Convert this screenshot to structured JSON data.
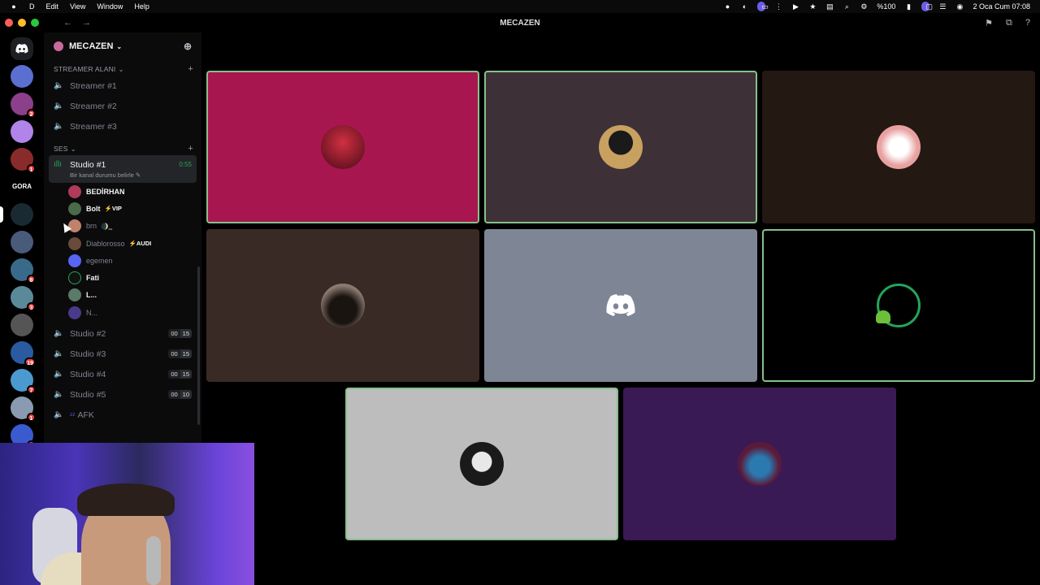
{
  "menubar": {
    "app_name": "D",
    "menus": [
      "Edit",
      "View",
      "Window",
      "Help"
    ],
    "battery": "%100",
    "datetime": "2 Oca Cum  07:08"
  },
  "titlebar": {
    "title": "MECAZEN"
  },
  "rail": {
    "servers": [
      {
        "name": "server-1",
        "color": "#5a6fd0",
        "badge": ""
      },
      {
        "name": "server-2",
        "color": "#8c3f8a",
        "badge": "2"
      },
      {
        "name": "server-3",
        "color": "#b084e8",
        "badge": ""
      },
      {
        "name": "server-4",
        "color": "#8a2b2b",
        "badge": "1"
      },
      {
        "name": "server-gora",
        "label": "GORA",
        "badge": ""
      },
      {
        "name": "server-mecazen",
        "color": "#1a2a33",
        "badge": "",
        "active": true
      },
      {
        "name": "server-7",
        "color": "#4a5a7a",
        "badge": ""
      },
      {
        "name": "server-8",
        "color": "#3a6a8a",
        "badge": "8"
      },
      {
        "name": "server-9",
        "color": "#5a8a9a",
        "badge": "3"
      },
      {
        "name": "server-10",
        "color": "#555",
        "badge": ""
      },
      {
        "name": "server-11",
        "color": "#2a5aa0",
        "badge": "19"
      },
      {
        "name": "server-12",
        "color": "#4a9ad0",
        "badge": "7"
      },
      {
        "name": "server-13",
        "color": "#8a9ab0",
        "badge": "1"
      },
      {
        "name": "server-14",
        "color": "#3a5ad0",
        "badge": "1"
      }
    ]
  },
  "sidebar": {
    "server_name": "MECAZEN",
    "categories": [
      {
        "label": "STREAMER ALANI",
        "channels": [
          {
            "label": "Streamer #1"
          },
          {
            "label": "Streamer #2"
          },
          {
            "label": "Streamer #3"
          }
        ]
      },
      {
        "label": "SES"
      }
    ],
    "active_channel": {
      "label": "Studio #1",
      "timer": "0:55",
      "status": "Bir kanal durumu belirle"
    },
    "members": [
      {
        "name": "BEDİRHAN",
        "color": "#b03a5a"
      },
      {
        "name": "Bolt",
        "tag": "⚡VIP",
        "color": "#4a6a4a"
      },
      {
        "name": "brn",
        "tag": "🌒ꞈꞈ",
        "color": "#c0826a",
        "dim": true
      },
      {
        "name": "Diablorosso",
        "tag": "⚡AUDI",
        "color": "#6a4a3a",
        "dim": true
      },
      {
        "name": "egemen",
        "color": "#5865f2",
        "dim": true
      },
      {
        "name": "Fati",
        "color": "#111"
      },
      {
        "name": "L...",
        "color": "#5a7a6a"
      },
      {
        "name": "N...",
        "color": "#4a3a8a",
        "dim": true
      }
    ],
    "other_channels": [
      {
        "label": "Studio #2",
        "count_a": "00",
        "count_b": "15"
      },
      {
        "label": "Studio #3",
        "count_a": "00",
        "count_b": "15"
      },
      {
        "label": "Studio #4",
        "count_a": "00",
        "count_b": "15"
      },
      {
        "label": "Studio #5",
        "count_a": "00",
        "count_b": "10"
      },
      {
        "label": "AFK",
        "count_a": "",
        "count_b": ""
      }
    ]
  },
  "video_tiles": [
    {
      "name": "tile-1",
      "bg": "#a8164f",
      "avatar": "#7a1a2a",
      "speaking": true
    },
    {
      "name": "tile-2",
      "bg": "#3d3137",
      "avatar": "#c8a060",
      "speaking": true
    },
    {
      "name": "tile-3",
      "bg": "#231812",
      "avatar": "#e8b0a8",
      "speaking": false
    },
    {
      "name": "tile-4",
      "bg": "#3a2a26",
      "avatar": "#5a4a40",
      "speaking": false
    },
    {
      "name": "tile-5",
      "bg": "#7e8595",
      "logo": true,
      "speaking": false
    },
    {
      "name": "tile-6",
      "bg": "#000000",
      "ring": true,
      "speaking": true
    },
    {
      "name": "tile-7",
      "bg": "#bdbdbd",
      "avatar": "#222",
      "speaking": true
    },
    {
      "name": "tile-8",
      "bg": "#3a1a55",
      "avatar": "#2a6a9a",
      "speaking": false
    }
  ]
}
